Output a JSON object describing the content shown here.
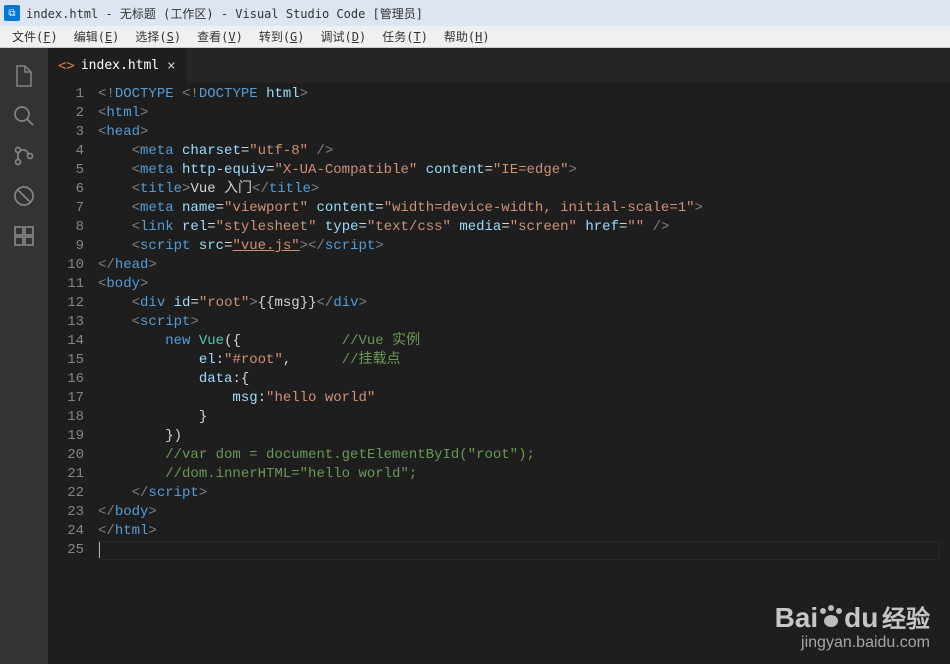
{
  "titlebar": {
    "title": "index.html - 无标题 (工作区) - Visual Studio Code [管理员]"
  },
  "menubar": {
    "items": [
      {
        "label": "文件(F)",
        "key": "F"
      },
      {
        "label": "编辑(E)",
        "key": "E"
      },
      {
        "label": "选择(S)",
        "key": "S"
      },
      {
        "label": "查看(V)",
        "key": "V"
      },
      {
        "label": "转到(G)",
        "key": "G"
      },
      {
        "label": "调试(D)",
        "key": "D"
      },
      {
        "label": "任务(T)",
        "key": "T"
      },
      {
        "label": "帮助(H)",
        "key": "H"
      }
    ]
  },
  "activitybar": {
    "icons": [
      "files",
      "search",
      "source-control",
      "debug",
      "extensions"
    ]
  },
  "tab": {
    "filename": "index.html"
  },
  "code": {
    "lines": 25,
    "content": [
      "<!DOCTYPE <!DOCTYPE html>",
      "<html>",
      "<head>",
      "    <meta charset=\"utf-8\" />",
      "    <meta http-equiv=\"X-UA-Compatible\" content=\"IE=edge\">",
      "    <title>Vue 入门</title>",
      "    <meta name=\"viewport\" content=\"width=device-width, initial-scale=1\">",
      "    <link rel=\"stylesheet\" type=\"text/css\" media=\"screen\" href=\"\" />",
      "    <script src=\"vue.js\"></script>",
      "</head>",
      "<body>",
      "    <div id=\"root\">{{msg}}</div>",
      "    <script>",
      "        new Vue({            //Vue 实例",
      "            el:\"#root\",      //挂载点",
      "            data:{",
      "                msg:\"hello world\"",
      "            }",
      "        })",
      "        //var dom = document.getElementById(\"root\");",
      "        //dom.innerHTML=\"hello world\";",
      "    </script>",
      "</body>",
      "</html>",
      ""
    ]
  },
  "watermark": {
    "brand": "Bai",
    "brand2": "du",
    "suffix": "经验",
    "url": "jingyan.baidu.com"
  }
}
